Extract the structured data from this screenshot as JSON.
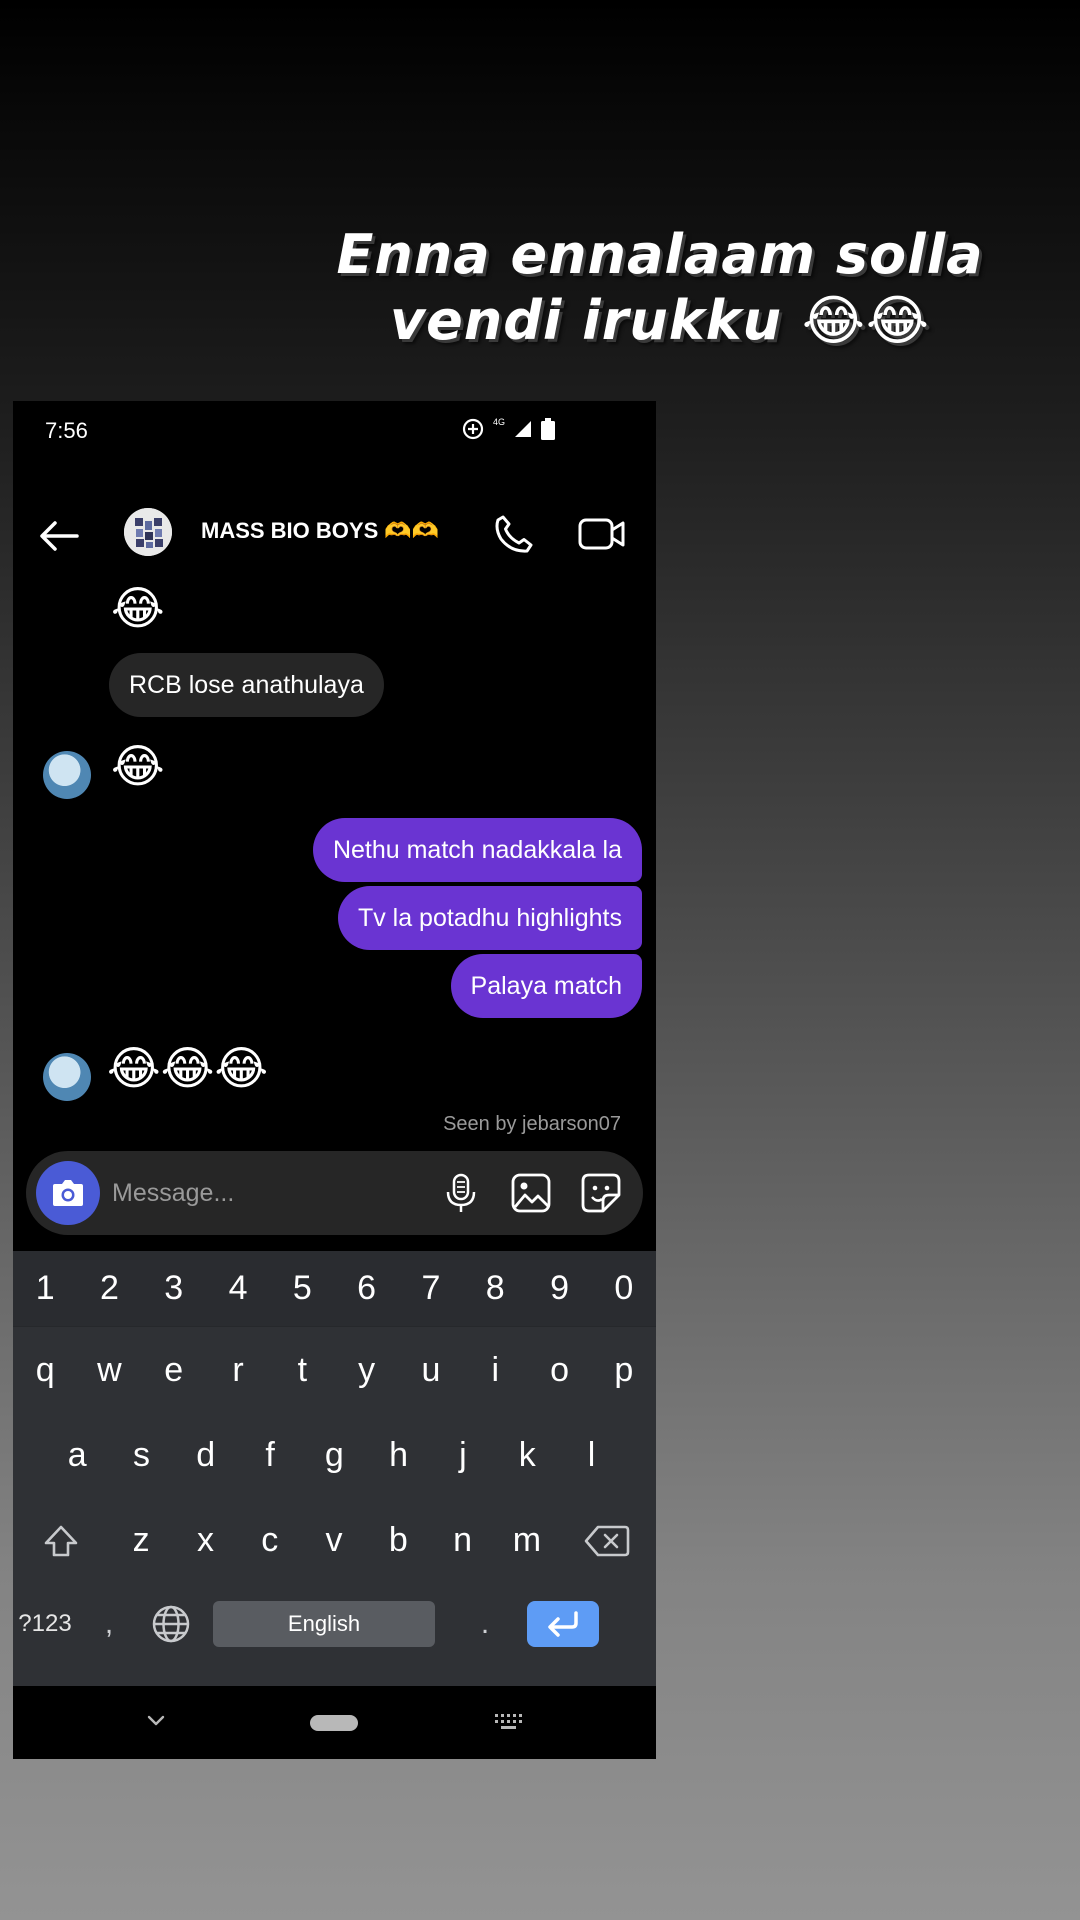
{
  "caption": {
    "line1": "Enna ennalaam solla",
    "line2": "vendi irukku 😂😂"
  },
  "status_bar": {
    "time": "7:56",
    "network": "4G"
  },
  "chat_header": {
    "title": "MASS BIO BOYS 🫶🫶"
  },
  "messages": {
    "m1_emoji": "😂",
    "m2_text": "RCB lose anathulaya",
    "m3_emoji": "😂",
    "m4_text": "Nethu match nadakkala la",
    "m5_text": "Tv la potadhu highlights",
    "m6_text": "Palaya match",
    "m7_emoji": "😂😂😂",
    "seen": "Seen by jebarson07"
  },
  "composer": {
    "placeholder": "Message..."
  },
  "keyboard": {
    "numbers": [
      "1",
      "2",
      "3",
      "4",
      "5",
      "6",
      "7",
      "8",
      "9",
      "0"
    ],
    "row1": [
      "q",
      "w",
      "e",
      "r",
      "t",
      "y",
      "u",
      "i",
      "o",
      "p"
    ],
    "row2": [
      "a",
      "s",
      "d",
      "f",
      "g",
      "h",
      "j",
      "k",
      "l"
    ],
    "row3": [
      "z",
      "x",
      "c",
      "v",
      "b",
      "n",
      "m"
    ],
    "symbols_key": "?123",
    "comma": ",",
    "space_label": "English",
    "period": "."
  },
  "colors": {
    "outgoing_bubble": "#6a34d2",
    "incoming_bubble": "#262626",
    "camera_button": "#4a5bd6",
    "enter_key": "#5e9cf5"
  }
}
